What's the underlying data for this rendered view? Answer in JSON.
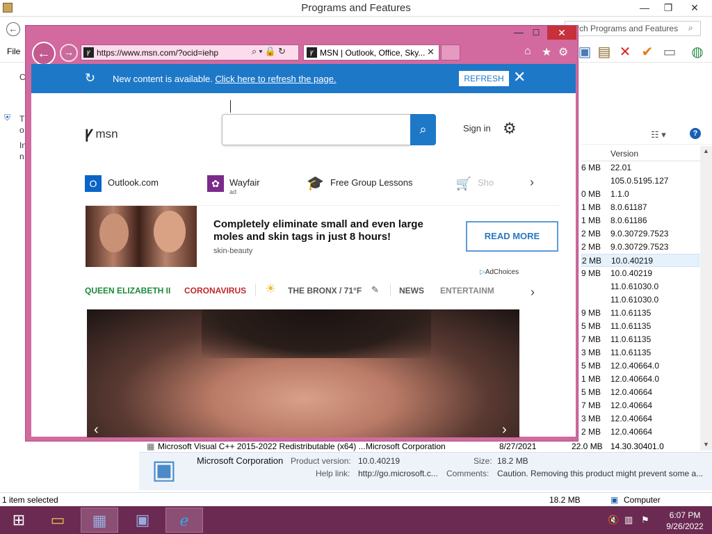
{
  "pf": {
    "title": "Programs and Features",
    "min": "—",
    "max": "❐",
    "close": "✕",
    "back": "←",
    "search_placeholder": "rch Programs and Features",
    "search_icon": "search-icon",
    "menu_file": "File",
    "left_texts": [
      "C",
      "T",
      "o",
      "In",
      "n"
    ],
    "column_version": "Version",
    "rows": [
      {
        "size": "6 MB",
        "version": "22.01"
      },
      {
        "size": "",
        "version": "105.0.5195.127"
      },
      {
        "size": "0 MB",
        "version": "1.1.0"
      },
      {
        "size": "1 MB",
        "version": "8.0.61187"
      },
      {
        "size": "1 MB",
        "version": "8.0.61186"
      },
      {
        "size": "2 MB",
        "version": "9.0.30729.7523"
      },
      {
        "size": "2 MB",
        "version": "9.0.30729.7523"
      },
      {
        "size": "2 MB",
        "version": "10.0.40219"
      },
      {
        "size": "9 MB",
        "version": "10.0.40219"
      },
      {
        "size": "",
        "version": "11.0.61030.0"
      },
      {
        "size": "",
        "version": "11.0.61030.0"
      },
      {
        "size": "9 MB",
        "version": "11.0.61135"
      },
      {
        "size": "5 MB",
        "version": "11.0.61135"
      },
      {
        "size": "7 MB",
        "version": "11.0.61135"
      },
      {
        "size": "3 MB",
        "version": "11.0.61135"
      },
      {
        "size": "5 MB",
        "version": "12.0.40664.0"
      },
      {
        "size": "1 MB",
        "version": "12.0.40664.0"
      },
      {
        "size": "5 MB",
        "version": "12.0.40664"
      },
      {
        "size": "7 MB",
        "version": "12.0.40664"
      },
      {
        "size": "3 MB",
        "version": "12.0.40664"
      },
      {
        "size": "2 MB",
        "version": "12.0.40664"
      }
    ],
    "last_row": {
      "name": "Microsoft Visual C++ 2015-2022 Redistributable (x64) ...",
      "publisher": "Microsoft Corporation",
      "date": "8/27/2021",
      "size": "22.0 MB",
      "version": "14.30.30401.0"
    },
    "details": {
      "publisher": "Microsoft Corporation",
      "product_version_label": "Product version:",
      "product_version": "10.0.40219",
      "size_label": "Size:",
      "size": "18.2 MB",
      "help_label": "Help link:",
      "help": "http://go.microsoft.c...",
      "comments_label": "Comments:",
      "comments": "Caution. Removing this product might prevent some a..."
    },
    "status": {
      "selected": "1 item selected",
      "size": "18.2 MB",
      "computer": "Computer"
    }
  },
  "ie": {
    "back": "←",
    "forward": "→",
    "url": "https://www.msn.com/?ocid=iehp",
    "tab_title": "MSN | Outlook, Office, Sky...",
    "tab_close": "✕",
    "min": "—",
    "max": "☐",
    "close": "✕",
    "home_icon": "⌂",
    "favorites_icon": "★",
    "tools_icon": "⚙"
  },
  "notif": {
    "text": "New content is available. ",
    "link": "Click here to refresh the page.",
    "button": "REFRESH",
    "close": "✕"
  },
  "msn": {
    "logo": "msn",
    "sign_in": "Sign in",
    "quick_links": [
      {
        "label": "Outlook.com",
        "icon": "outlook-icon",
        "color": "#0a64c8"
      },
      {
        "label": "Wayfair",
        "sub": "ad",
        "icon": "wayfair-icon",
        "color": "#7b2a8b"
      },
      {
        "label": "Free Group Lessons",
        "icon": "graduation-cap-icon",
        "color": "#5b2a86"
      },
      {
        "label": "Sho",
        "icon": "shopping-cart-icon",
        "color": "#2a8de8"
      }
    ],
    "ad": {
      "title": "Completely eliminate small and even large moles and skin tags in just 8 hours!",
      "source": "skin-beauty",
      "button": "READ MORE",
      "adchoices": "AdChoices"
    },
    "nav": [
      {
        "label": "QUEEN ELIZABETH II",
        "color": "#1a8a3a"
      },
      {
        "label": "CORONAVIRUS",
        "color": "#c0282e"
      },
      {
        "label": "THE BRONX / 71°F",
        "color": "#555555"
      },
      {
        "label": "NEWS",
        "color": "#555555"
      },
      {
        "label": "ENTERTAINM",
        "color": "#777777"
      }
    ]
  },
  "taskbar": {
    "time": "6:07 PM",
    "date": "9/26/2022"
  }
}
